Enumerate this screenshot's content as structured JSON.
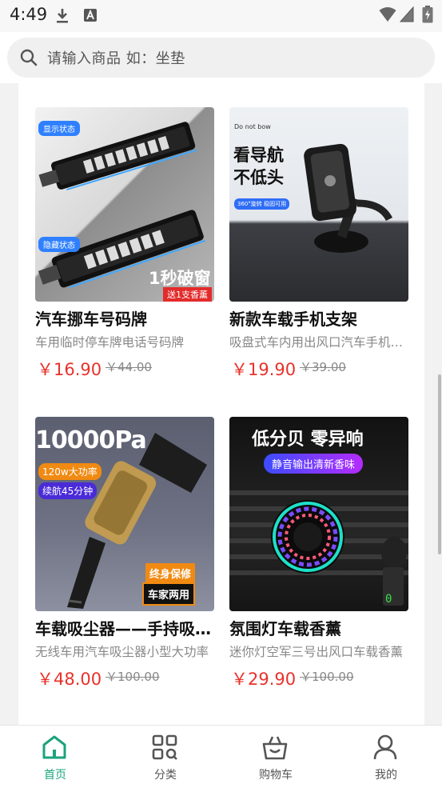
{
  "status_bar": {
    "time": "4:49"
  },
  "search": {
    "placeholder": "请输入商品  如：坐垫"
  },
  "products": [
    {
      "name": "汽车挪车号码牌",
      "desc": "车用临时停车牌电话号码牌",
      "price": "￥16.90",
      "old_price": "￥44.00",
      "image_texts": {
        "tag1": "显示状态",
        "tag2": "隐藏状态",
        "slogan": "1秒破窗",
        "gift": "送1支香薰"
      }
    },
    {
      "name": "新款车载手机支架",
      "desc": "吸盘式车内用出风口汽车手机支架",
      "price": "￥19.90",
      "old_price": "￥39.00",
      "image_texts": {
        "brand": "Do not bow",
        "line1": "看导航",
        "line2": "不低头",
        "badge": "360°旋转 稳固可用"
      }
    },
    {
      "name": "车载吸尘器——手持吸尘器",
      "desc": "无线车用汽车吸尘器小型大功率",
      "price": "￥48.00",
      "old_price": "￥100.00",
      "image_texts": {
        "big": "10000Pa",
        "tag1": "120w大功率",
        "tag2": "续航45分钟",
        "badge1": "终身保修",
        "badge2": "车家两用"
      }
    },
    {
      "name": "氛围灯车载香薰",
      "desc": "迷你灯空军三号出风口车载香薰",
      "price": "￥29.90",
      "old_price": "￥100.00",
      "image_texts": {
        "headline": "低分贝 零异响",
        "sub": "静音输出清新香味"
      }
    }
  ],
  "nav": {
    "items": [
      {
        "label": "首页",
        "icon": "home-icon"
      },
      {
        "label": "分类",
        "icon": "category-icon"
      },
      {
        "label": "购物车",
        "icon": "cart-icon"
      },
      {
        "label": "我的",
        "icon": "user-icon"
      }
    ],
    "active_color": "#1aa37b",
    "price_color": "#e8322b"
  }
}
